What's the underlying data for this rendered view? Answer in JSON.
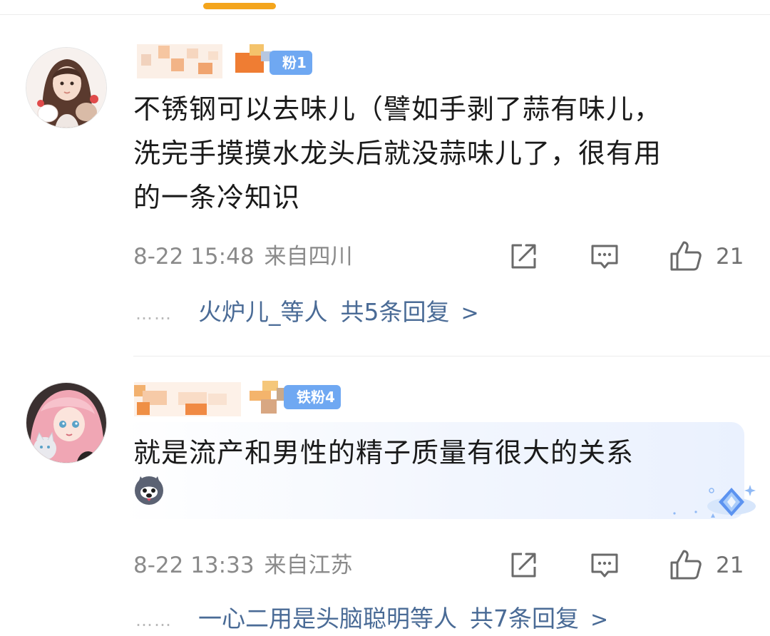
{
  "comments": [
    {
      "fan_badge": "粉1",
      "text_lines": [
        "不锈钢可以去味儿（譬如手剥了蒜有味儿，",
        "洗完手摸摸水龙头后就没蒜味儿了，很有用",
        "的一条冷知识"
      ],
      "date": "8-22 15:48",
      "location": "来自四川",
      "like_count": "21",
      "replies": {
        "dots": "……",
        "users": "火炉儿_等人",
        "count": "共5条回复",
        "chevron": ">"
      }
    },
    {
      "fan_badge": "铁粉4",
      "text_lines": [
        "就是流产和男性的精子质量有很大的关系"
      ],
      "emoji": "husky-dog-emoji",
      "date": "8-22 13:33",
      "location": "来自江苏",
      "like_count": "21",
      "replies": {
        "dots": "……",
        "users": "一心二用是头脑聪明等人",
        "count": "共7条回复",
        "chevron": ">"
      }
    }
  ],
  "icons": {
    "share": "share-icon",
    "comment": "comment-icon",
    "like": "thumbs-up-icon",
    "badge": "diamond-badge-icon"
  },
  "colors": {
    "tab_indicator": "#f4a51c",
    "link": "#4a6b96",
    "meta": "#8a8a8a",
    "fan_badge": "#6fa8f2"
  }
}
